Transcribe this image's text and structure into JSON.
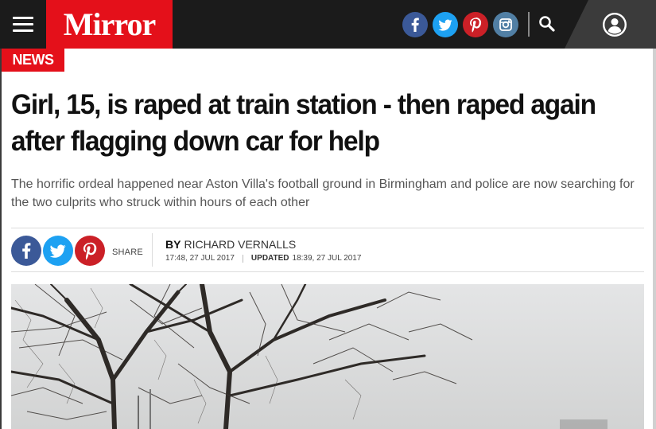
{
  "header": {
    "logo_text": "Mirror",
    "brand_color": "#e4101a",
    "bar_color": "#1b1b1b",
    "social_icons": [
      {
        "name": "facebook-icon",
        "color": "#3b5998"
      },
      {
        "name": "twitter-icon",
        "color": "#1da1f2"
      },
      {
        "name": "pinterest-icon",
        "color": "#cb2027"
      },
      {
        "name": "instagram-icon",
        "color": "#517fa4"
      }
    ],
    "menu_icon": "hamburger-menu-icon",
    "search_icon": "search-icon",
    "account_icon": "user-account-icon"
  },
  "article": {
    "section_tag": "NEWS",
    "headline": "Girl, 15, is raped at train station - then raped again after flagging down car for help",
    "standfirst": "The horrific ordeal happened near Aston Villa's football ground in Birmingham and police are now searching for the two culprits who struck within hours of each other",
    "share": {
      "label": "SHARE",
      "buttons": [
        {
          "name": "facebook-icon",
          "color": "#3b5998"
        },
        {
          "name": "twitter-icon",
          "color": "#1da1f2"
        },
        {
          "name": "pinterest-icon",
          "color": "#cb2027"
        }
      ]
    },
    "byline": {
      "by_label": "BY",
      "author": "Richard Vernalls",
      "published": "17:48, 27 JUL 2017",
      "updated_label": "UPDATED",
      "updated": "18:39, 27 JUL 2017"
    },
    "hero_image": {
      "description_name": "hero-photo-bare-trees"
    }
  }
}
